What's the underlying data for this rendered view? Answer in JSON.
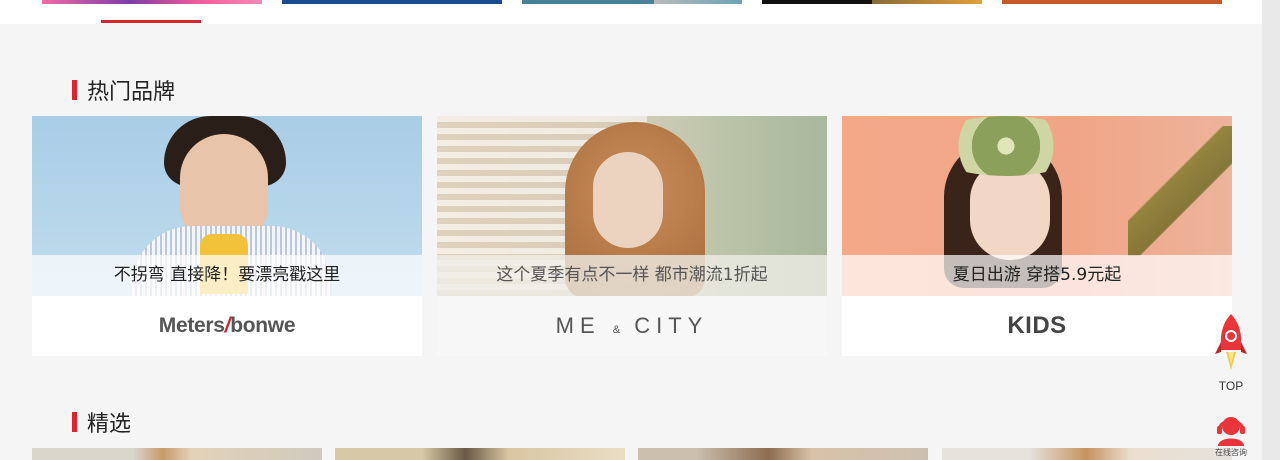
{
  "sections": {
    "hot_brands_title": "热门品牌",
    "featured_title": "精选"
  },
  "brands": [
    {
      "caption": "不拐弯 直接降！要漂亮戳这里",
      "logo_main": "Meters",
      "logo_slash": "/",
      "logo_tail": "bonwe"
    },
    {
      "caption": "这个夏季有点不一样 都市潮流1折起",
      "logo_left": "ME",
      "logo_amp": "&",
      "logo_right": "CITY"
    },
    {
      "caption": "夏日出游 穿搭5.9元起",
      "logo_main": "KIDS"
    }
  ],
  "float": {
    "top_label": "TOP",
    "consult_label": "在线咨询"
  },
  "colors": {
    "accent": "#d8262f",
    "background": "#f5f5f5"
  }
}
